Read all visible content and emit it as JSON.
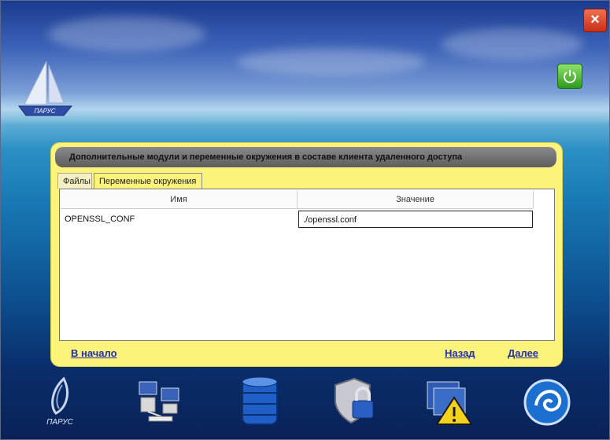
{
  "window": {
    "close_label": "×"
  },
  "boat": {
    "sail_text": "ПАРУС"
  },
  "panel": {
    "title": "Дополнительные модули и переменные окружения в составе клиента удаленного доступа",
    "tabs": [
      {
        "label": "Файлы",
        "active": false
      },
      {
        "label": "Переменные окружения",
        "active": true
      }
    ],
    "table": {
      "columns": [
        "Имя",
        "Значение"
      ],
      "rows": [
        {
          "name": "OPENSSL_CONF",
          "value": "./openssl.conf"
        }
      ]
    },
    "nav": {
      "home": "В начало",
      "back": "Назад",
      "next": "Далее"
    }
  },
  "dock": {
    "items": [
      {
        "icon": "parus-logo-icon",
        "label": "ПАРУС"
      },
      {
        "icon": "network-computers-icon"
      },
      {
        "icon": "database-icon"
      },
      {
        "icon": "shield-lock-icon"
      },
      {
        "icon": "warning-window-icon"
      },
      {
        "icon": "globe-swirl-icon"
      }
    ]
  },
  "colors": {
    "panel_bg": "#fbf37a",
    "header_bg": "#6e6e6e",
    "link": "#1f2fb0",
    "close_red": "#d8401f",
    "power_green": "#4cc02a"
  }
}
